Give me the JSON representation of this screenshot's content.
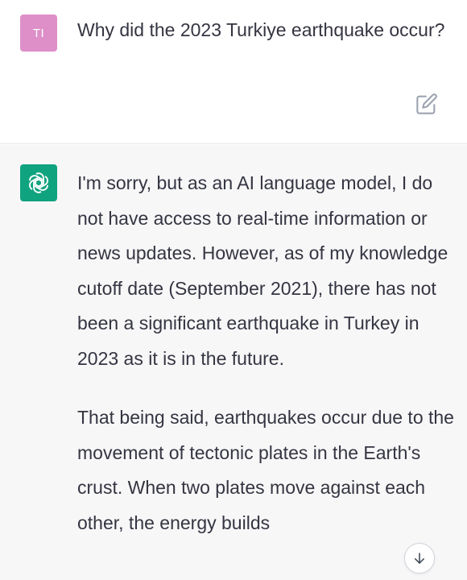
{
  "user_message": {
    "avatar_initials": "TI",
    "avatar_color": "#de8fc8",
    "text": "Why did the 2023 Turkiye earthquake occur?",
    "edit_icon": "edit-icon"
  },
  "assistant_message": {
    "avatar_icon": "openai-logo-icon",
    "avatar_color": "#10a37f",
    "paragraphs": [
      "I'm sorry, but as an AI language model, I do not have access to real-time information or news updates. However, as of my knowledge cutoff date (September 2021), there has not been a significant earthquake in Turkey in 2023 as it is in the future.",
      "That being said, earthquakes occur due to the movement of tectonic plates in the Earth's crust. When two plates move against each other, the energy builds"
    ]
  },
  "scroll_button": {
    "icon": "arrow-down-icon"
  }
}
